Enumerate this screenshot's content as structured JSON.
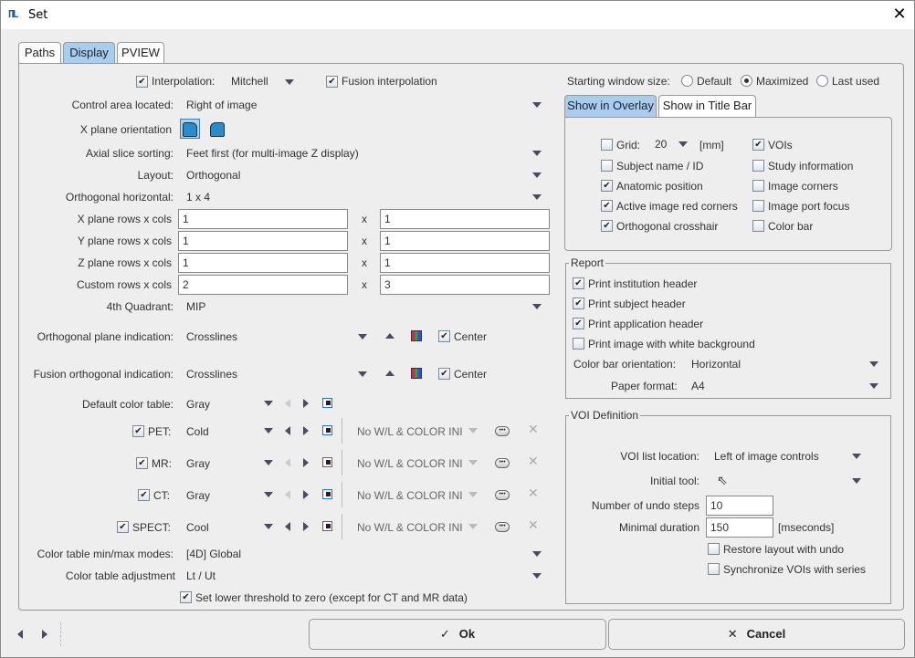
{
  "window": {
    "title": "Set",
    "app_icon": "pmod-logo-icon",
    "close_icon": "close-icon"
  },
  "tabs": [
    {
      "label": "Paths",
      "active": false
    },
    {
      "label": "Display",
      "active": true
    },
    {
      "label": "PVIEW",
      "active": false
    }
  ],
  "left": {
    "interpolation": {
      "label": "Interpolation:",
      "checked": true,
      "value": "Mitchell"
    },
    "fusion_interpolation": {
      "label": "Fusion interpolation",
      "checked": true
    },
    "control_area": {
      "label": "Control area located:",
      "value": "Right of image"
    },
    "x_plane_orientation": {
      "label": "X plane orientation",
      "options": [
        "head-right-icon",
        "head-left-icon"
      ],
      "selected": 0
    },
    "axial_slice_sorting": {
      "label": "Axial slice sorting:",
      "value": "Feet first  (for multi-image Z display)"
    },
    "layout": {
      "label": "Layout:",
      "value": "Orthogonal"
    },
    "orthogonal_horizontal": {
      "label": "Orthogonal horizontal:",
      "value": "1 x 4"
    },
    "grids": [
      {
        "label": "X plane rows x cols",
        "rows": "1",
        "cols": "1"
      },
      {
        "label": "Y plane rows x cols",
        "rows": "1",
        "cols": "1"
      },
      {
        "label": "Z plane rows x cols",
        "rows": "1",
        "cols": "1"
      },
      {
        "label": "Custom rows x cols",
        "rows": "2",
        "cols": "3"
      }
    ],
    "times_sign": "x",
    "fourth_quadrant": {
      "label": "4th Quadrant:",
      "value": "MIP"
    },
    "orthogonal_plane_indication": {
      "label": "Orthogonal plane indication:",
      "value": "Crosslines",
      "center_label": "Center",
      "center_checked": true
    },
    "fusion_orthogonal_indication": {
      "label": "Fusion orthogonal indication:",
      "value": "Crosslines",
      "center_label": "Center",
      "center_checked": true
    },
    "default_color_table": {
      "label": "Default color table:",
      "value": "Gray"
    },
    "modalities": [
      {
        "label": "PET:",
        "checked": true,
        "table": "Cold",
        "preset": "No W/L & COLOR INI"
      },
      {
        "label": "MR:",
        "checked": true,
        "table": "Gray",
        "preset": "No W/L & COLOR INI"
      },
      {
        "label": "CT:",
        "checked": true,
        "table": "Gray",
        "preset": "No W/L & COLOR INI"
      },
      {
        "label": "SPECT:",
        "checked": true,
        "table": "Cool",
        "preset": "No W/L & COLOR INI"
      }
    ],
    "minmax_modes": {
      "label": "Color table min/max modes:",
      "value": "[4D] Global"
    },
    "adjustment": {
      "label": "Color table adjustment",
      "value": "Lt / Ut"
    },
    "lower_threshold": {
      "label": "Set lower threshold to zero (except for CT and MR data)",
      "checked": true
    }
  },
  "right": {
    "starting_window": {
      "label": "Starting window size:",
      "options": [
        "Default",
        "Maximized",
        "Last used"
      ],
      "selected": "Maximized"
    },
    "subtabs": [
      {
        "label": "Show in Overlay",
        "active": true
      },
      {
        "label": "Show in Title Bar",
        "active": false
      }
    ],
    "overlay": {
      "grid": {
        "label": "Grid:",
        "checked": false,
        "value": "20",
        "unit": "[mm]"
      },
      "left_items": [
        {
          "label": "Subject name / ID",
          "checked": false
        },
        {
          "label": "Anatomic position",
          "checked": true
        },
        {
          "label": "Active image red corners",
          "checked": true
        },
        {
          "label": "Orthogonal crosshair",
          "checked": true
        }
      ],
      "right_items": [
        {
          "label": "VOIs",
          "checked": true
        },
        {
          "label": "Study information",
          "checked": false
        },
        {
          "label": "Image corners",
          "checked": false
        },
        {
          "label": "Image port focus",
          "checked": false
        },
        {
          "label": "Color bar",
          "checked": false
        }
      ]
    },
    "report": {
      "title": "Report",
      "items": [
        {
          "label": "Print institution header",
          "checked": true
        },
        {
          "label": "Print subject header",
          "checked": true
        },
        {
          "label": "Print application header",
          "checked": true
        },
        {
          "label": "Print image with white background",
          "checked": false
        }
      ],
      "color_bar_orientation": {
        "label": "Color bar orientation:",
        "value": "Horizontal"
      },
      "paper_format": {
        "label": "Paper format:",
        "value": "A4"
      }
    },
    "voi": {
      "title": "VOI Definition",
      "list_location": {
        "label": "VOI list location:",
        "value": "Left of image controls"
      },
      "initial_tool": {
        "label": "Initial tool:",
        "value": ""
      },
      "undo_steps": {
        "label": "Number of undo steps",
        "value": "10"
      },
      "minimal_duration": {
        "label": "Minimal duration",
        "value": "150",
        "unit": "[mseconds]"
      },
      "restore_layout": {
        "label": "Restore layout with undo",
        "checked": false
      },
      "sync_vois": {
        "label": "Synchronize VOIs with series",
        "checked": false
      }
    }
  },
  "footer": {
    "ok_label": "Ok",
    "cancel_label": "Cancel",
    "check_glyph": "✓",
    "x_glyph": "✕"
  },
  "glyphs": {
    "check": "✔"
  }
}
